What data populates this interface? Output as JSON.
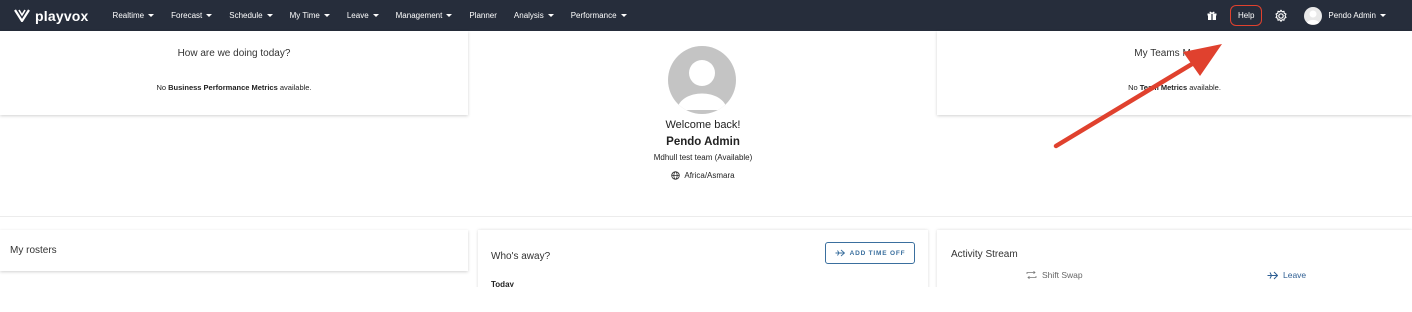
{
  "topbar": {
    "logo_text": "playvox",
    "nav_items": [
      {
        "label": "Realtime",
        "dropdown": true
      },
      {
        "label": "Forecast",
        "dropdown": true
      },
      {
        "label": "Schedule",
        "dropdown": true
      },
      {
        "label": "My Time",
        "dropdown": true
      },
      {
        "label": "Leave",
        "dropdown": true
      },
      {
        "label": "Management",
        "dropdown": true
      },
      {
        "label": "Planner",
        "dropdown": false
      },
      {
        "label": "Analysis",
        "dropdown": true
      },
      {
        "label": "Performance",
        "dropdown": true
      }
    ],
    "help_label": "Help",
    "user_name": "Pendo Admin",
    "background_color": "#262d3b",
    "help_border_color": "#e0412e"
  },
  "business_card": {
    "title": "How are we doing today?",
    "prefix": "No ",
    "bold": "Business Performance Metrics",
    "suffix": " available."
  },
  "profile": {
    "welcome": "Welcome back!",
    "name": "Pendo Admin",
    "team": "Mdhull test team (Available)",
    "timezone": "Africa/Asmara"
  },
  "team_card": {
    "title": "My Teams Metrics",
    "prefix": "No ",
    "bold": "Team Metrics",
    "suffix": " available."
  },
  "rosters": {
    "title": "My rosters"
  },
  "away": {
    "title": "Who's away?",
    "add_button": "ADD TIME OFF",
    "today_label": "Today"
  },
  "activity": {
    "title": "Activity Stream",
    "tabs": [
      {
        "label": "Shift Swap",
        "icon": "swap-icon"
      },
      {
        "label": "Leave",
        "icon": "leave-icon"
      }
    ],
    "accent_color": "#2f5f93"
  },
  "annotation": {
    "arrow_color": "#e0412e",
    "points_to": "help-button"
  }
}
